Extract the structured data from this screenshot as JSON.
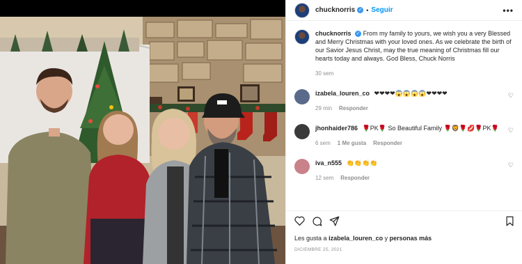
{
  "post": {
    "username": "chucknorris",
    "verified_mark": "✓",
    "dot": "•",
    "follow_label": "Seguir",
    "more_label": "•••",
    "caption": {
      "username": "chucknorris",
      "text": "From my family to yours, we wish you a very Blessed and Merry Christmas with your loved ones. As we celebrate the birth of our Savior Jesus Christ, may the true meaning of Christmas fill our hearts today and always. God Bless, Chuck Norris",
      "time": "30 sem"
    },
    "comments": [
      {
        "username": "izabela_louren_co",
        "text": "❤❤❤❤😱😱😱😱❤❤❤❤",
        "time": "29 min",
        "likes": "",
        "reply": "Responder",
        "avatar_color": "#5a6a8a"
      },
      {
        "username": "jhonhaider786",
        "text": "🌹PK🌹 So Beautiful Family 🌹🦁🌹💋🌹PK🌹",
        "time": "6 sem",
        "likes": "1 Me gusta",
        "reply": "Responder",
        "avatar_color": "#3a3a3a"
      },
      {
        "username": "iva_n555",
        "text": "👏👏👏👏",
        "time": "12 sem",
        "likes": "",
        "reply": "Responder",
        "avatar_color": "#c9828a"
      }
    ],
    "actions": {
      "like_icon": "heart-icon",
      "comment_icon": "comment-icon",
      "share_icon": "share-icon",
      "save_icon": "bookmark-icon"
    },
    "likes_prefix": "Les gusta a",
    "likes_user": "izabela_louren_co",
    "likes_suffix": "y",
    "likes_others": "personas más",
    "date": "DICIEMBRE 25, 2021"
  }
}
